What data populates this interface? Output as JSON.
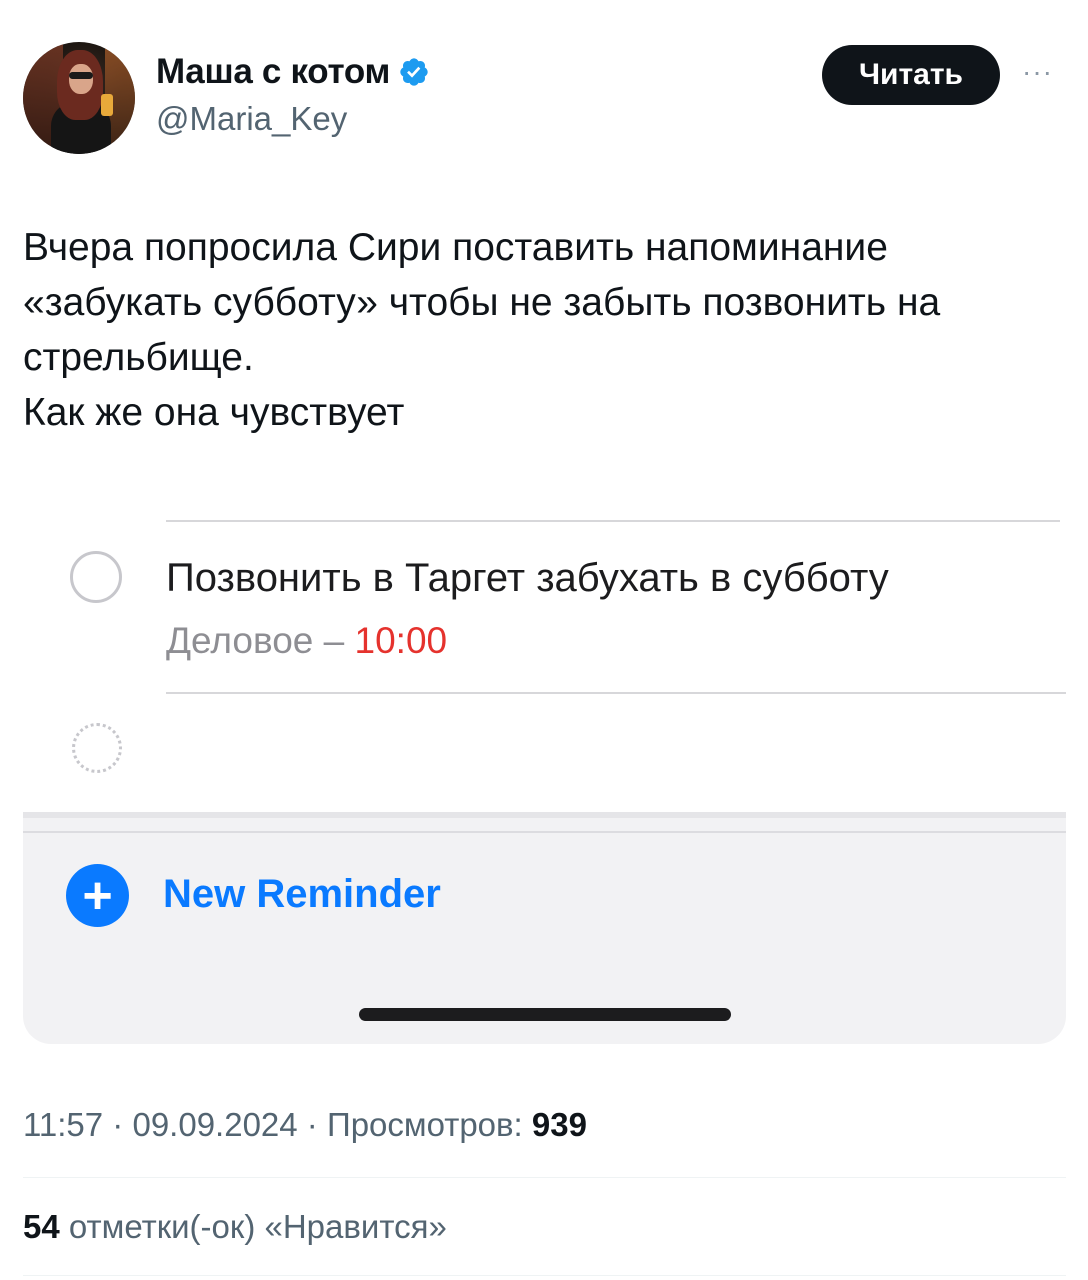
{
  "author": {
    "display_name": "Маша с котом",
    "handle": "@Maria_Key",
    "verified_icon": "verified-badge-icon"
  },
  "actions": {
    "follow_label": "Читать",
    "more_label": "···"
  },
  "tweet": {
    "lines": [
      "Вчера попросила Сири поставить напоминание",
      "«забукать субботу» чтобы не забыть позвонить на",
      "стрельбище.",
      "Как же она чувствует"
    ]
  },
  "media": {
    "reminder_title": "Позвонить в Таргет забухать в субботу",
    "reminder_list": "Деловое",
    "reminder_sep": " – ",
    "reminder_time": "10:00",
    "new_reminder_label": "New Reminder",
    "accent_color": "#0a7aff",
    "time_color": "#e5322d"
  },
  "meta": {
    "time": "11:57",
    "dot": " · ",
    "date": "09.09.2024",
    "views_label": "Просмотров: ",
    "views_count": "939"
  },
  "engagement": {
    "likes_count": "54",
    "likes_label": " отметки(-ок) «Нравится»"
  }
}
